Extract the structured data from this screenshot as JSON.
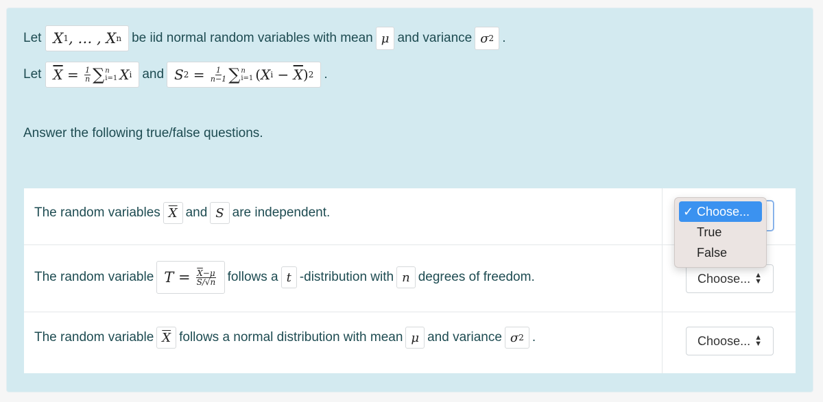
{
  "intro": {
    "line1": {
      "let": "Let",
      "vars_math": "X₁, …, Xₙ",
      "text1": "be iid normal random variables with mean",
      "mean_math": "μ",
      "text2": "and variance",
      "var_math": "σ²",
      "end": "."
    },
    "line2": {
      "let": "Let",
      "xbar_def": "X̄ = (1/n) Σᵢ₌₁ⁿ Xᵢ",
      "and": "and",
      "s2_def": "S² = (1/(n−1)) Σᵢ₌₁ⁿ (Xᵢ − X̄)²",
      "end": "."
    },
    "instructions": "Answer the following true/false questions."
  },
  "questions": [
    {
      "parts": [
        "The random variables",
        "X̄",
        "and",
        "S",
        "are independent."
      ],
      "answer": "Choose...",
      "dropdown_open": true
    },
    {
      "parts": [
        "The random variable",
        "T = (X̄ − μ)/(S/√n)",
        "follows a",
        "t",
        "-distribution with",
        "n",
        "degrees of freedom."
      ],
      "answer": "Choose..."
    },
    {
      "parts": [
        "The random variable",
        "X̄",
        "follows a normal distribution with mean",
        "μ",
        "and variance",
        "σ²",
        "."
      ],
      "answer": "Choose..."
    }
  ],
  "dropdown": {
    "options": [
      "Choose...",
      "True",
      "False"
    ],
    "selected": "Choose...",
    "check": "✓"
  },
  "colors": {
    "panel_bg": "#d3eaf0",
    "text": "#1d4b51",
    "highlight": "#3b92f0"
  }
}
